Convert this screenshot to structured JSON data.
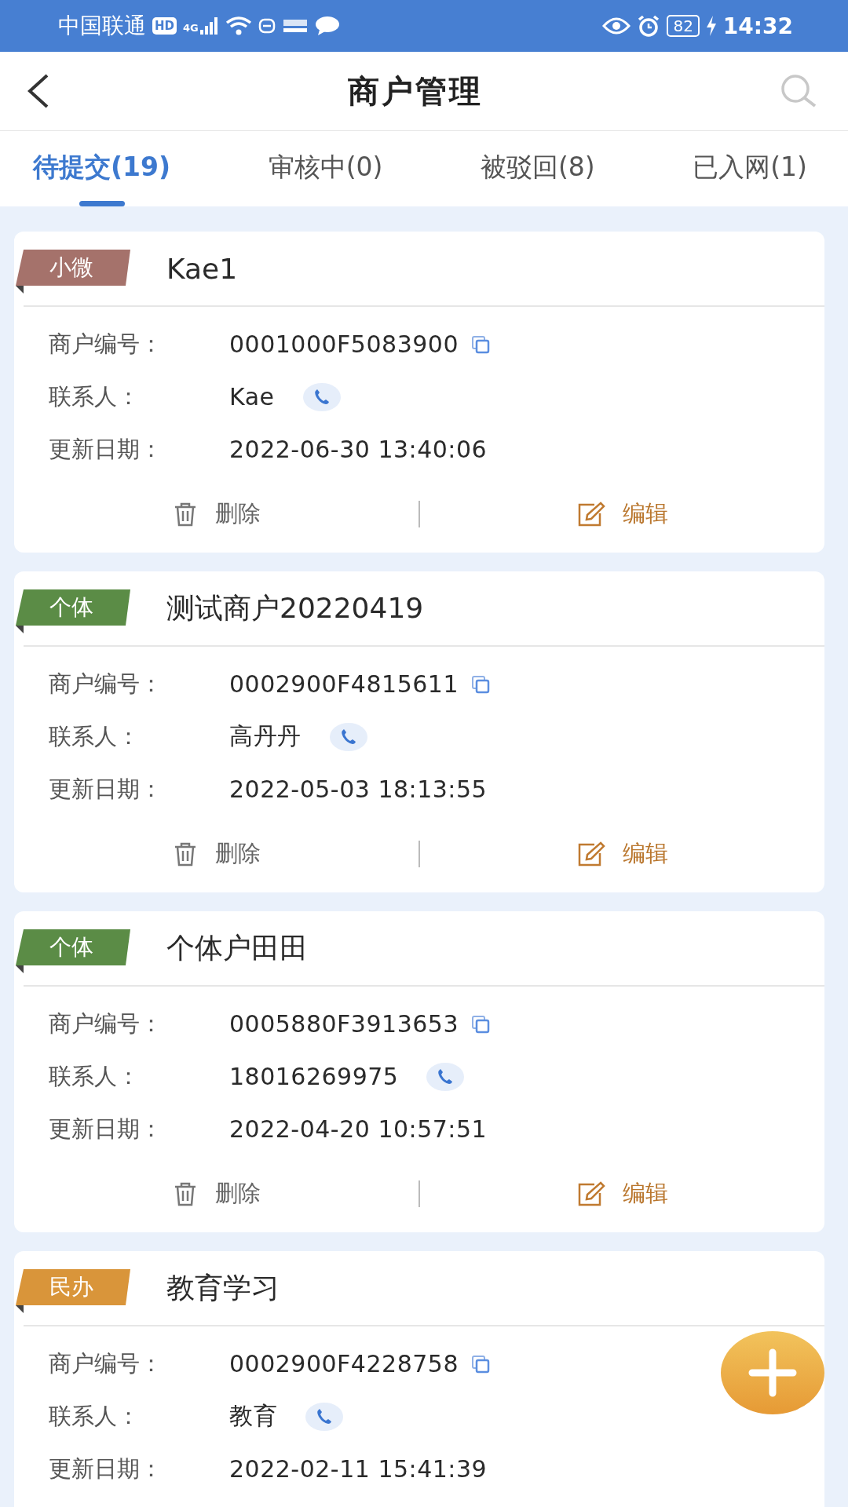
{
  "status_bar": {
    "carrier": "中国联通",
    "hd": "HD",
    "network": "4G",
    "battery": "82",
    "time": "14:32"
  },
  "header": {
    "title": "商户管理"
  },
  "tabs": [
    {
      "label": "待提交(19)",
      "selected": true
    },
    {
      "label": "审核中(0)",
      "selected": false
    },
    {
      "label": "被驳回(8)",
      "selected": false
    },
    {
      "label": "已入网(1)",
      "selected": false
    }
  ],
  "merchants": [
    {
      "tag": "小微",
      "color": "#a5726b",
      "name": "Kae1",
      "fields": [
        {
          "label": "商户编号：",
          "value": "0001000F5083900",
          "kind": "copy"
        },
        {
          "label": "联系人：",
          "value": "Kae",
          "kind": "call"
        },
        {
          "label": "更新日期：",
          "value": "2022-06-30 13:40:06",
          "kind": "text"
        }
      ],
      "actions": [
        {
          "kind": "delete",
          "label": "删除"
        },
        {
          "kind": "edit",
          "label": "编辑"
        }
      ]
    },
    {
      "tag": "个体",
      "color": "#5b8c46",
      "name": "测试商户20220419",
      "fields": [
        {
          "label": "商户编号：",
          "value": "0002900F4815611",
          "kind": "copy"
        },
        {
          "label": "联系人：",
          "value": "高丹丹",
          "kind": "call"
        },
        {
          "label": "更新日期：",
          "value": "2022-05-03 18:13:55",
          "kind": "text"
        }
      ],
      "actions": [
        {
          "kind": "delete",
          "label": "删除"
        },
        {
          "kind": "edit",
          "label": "编辑"
        }
      ]
    },
    {
      "tag": "个体",
      "color": "#5b8c46",
      "name": "个体户田田",
      "fields": [
        {
          "label": "商户编号：",
          "value": "0005880F3913653",
          "kind": "copy"
        },
        {
          "label": "联系人：",
          "value": "18016269975",
          "kind": "call"
        },
        {
          "label": "更新日期：",
          "value": "2022-04-20 10:57:51",
          "kind": "text"
        }
      ],
      "actions": [
        {
          "kind": "delete",
          "label": "删除"
        },
        {
          "kind": "edit",
          "label": "编辑"
        }
      ]
    },
    {
      "tag": "民办",
      "color": "#d9953a",
      "name": "教育学习",
      "fields": [
        {
          "label": "商户编号：",
          "value": "0002900F4228758",
          "kind": "copy"
        },
        {
          "label": "联系人：",
          "value": "教育",
          "kind": "call"
        },
        {
          "label": "更新日期：",
          "value": "2022-02-11 15:41:39",
          "kind": "text"
        }
      ]
    }
  ]
}
